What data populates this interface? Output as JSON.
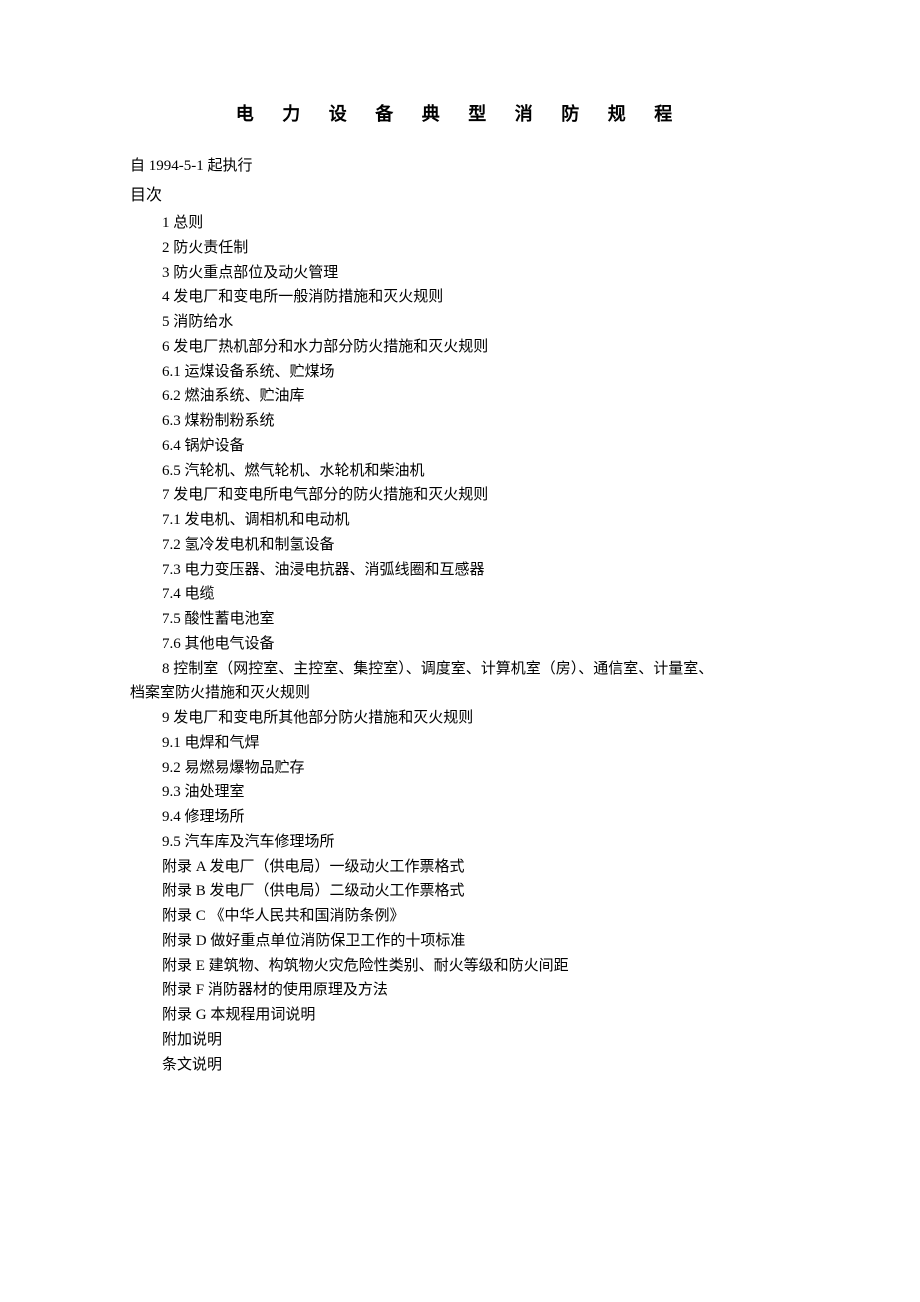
{
  "title": "电 力 设 备 典 型 消 防 规 程",
  "effective_line": "自 1994-5-1 起执行",
  "toc_header": "目次",
  "toc": [
    "1 总则",
    "2 防火责任制",
    "3 防火重点部位及动火管理",
    "4 发电厂和变电所一般消防措施和灭火规则",
    "5 消防给水",
    "6 发电厂热机部分和水力部分防火措施和灭火规则",
    "6.1 运煤设备系统、贮煤场",
    "6.2 燃油系统、贮油库",
    "6.3 煤粉制粉系统",
    "6.4 锅炉设备",
    "6.5 汽轮机、燃气轮机、水轮机和柴油机",
    "7 发电厂和变电所电气部分的防火措施和灭火规则",
    "7.1 发电机、调相机和电动机",
    "7.2 氢冷发电机和制氢设备",
    "7.3 电力变压器、油浸电抗器、消弧线圈和互感器",
    "7.4 电缆",
    "7.5 酸性蓄电池室",
    "7.6 其他电气设备"
  ],
  "toc_wrap_first": "8 控制室（网控室、主控室、集控室）、调度室、计算机室（房）、通信室、计量室、",
  "toc_wrap_cont": "档案室防火措施和灭火规则",
  "toc2": [
    "9 发电厂和变电所其他部分防火措施和灭火规则",
    "9.1 电焊和气焊",
    "9.2 易燃易爆物品贮存",
    "9.3 油处理室",
    "9.4 修理场所",
    "9.5 汽车库及汽车修理场所",
    "附录 A 发电厂（供电局）一级动火工作票格式",
    "附录 B 发电厂（供电局）二级动火工作票格式",
    "附录 C 《中华人民共和国消防条例》",
    "附录 D 做好重点单位消防保卫工作的十项标准",
    "附录 E 建筑物、构筑物火灾危险性类别、耐火等级和防火间距",
    "附录 F 消防器材的使用原理及方法",
    "附录 G 本规程用词说明",
    "附加说明",
    "条文说明"
  ]
}
